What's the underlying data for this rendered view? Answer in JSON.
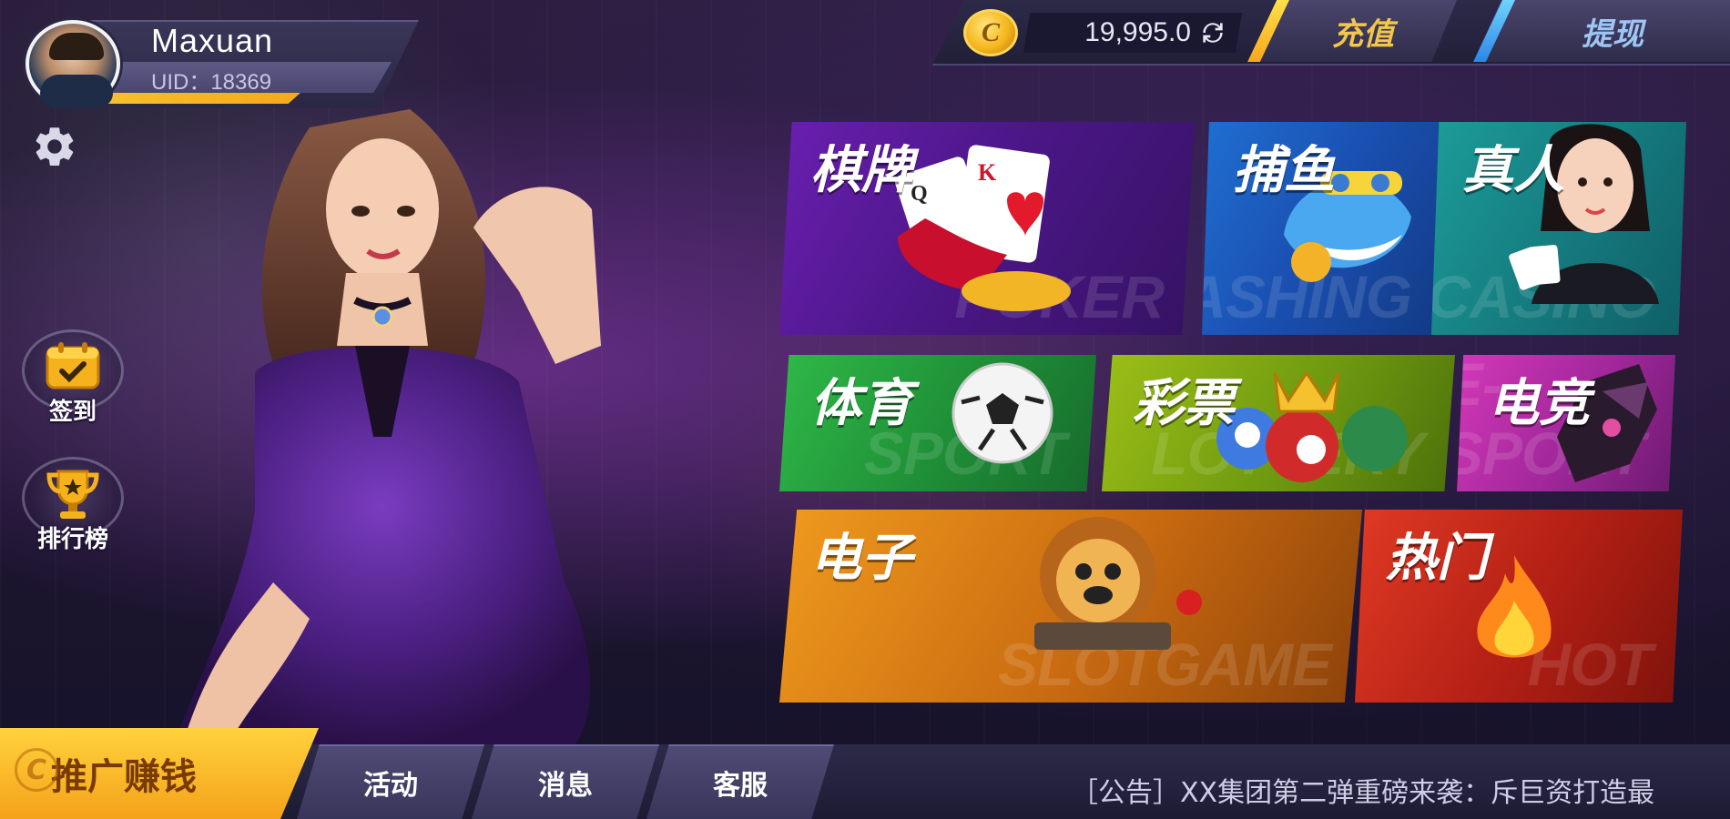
{
  "user": {
    "name": "Maxuan",
    "uid": "UID：18369"
  },
  "wallet": {
    "balance": "19,995.0",
    "recharge_label": "充值",
    "withdraw_label": "提现",
    "coin_symbol": "C"
  },
  "side": {
    "checkin_label": "签到",
    "ranking_label": "排行榜"
  },
  "games": [
    {
      "title": "棋牌",
      "subtitle": "POKER"
    },
    {
      "title": "捕鱼",
      "subtitle": "FASHING"
    },
    {
      "title": "真人",
      "subtitle": "CASINO"
    },
    {
      "title": "体育",
      "subtitle": "SPORT"
    },
    {
      "title": "彩票",
      "subtitle": "LOTTERY"
    },
    {
      "title": "电竞",
      "subtitle": "E-SPORT"
    },
    {
      "title": "电子",
      "subtitle": "SLOTGAME"
    },
    {
      "title": "热门",
      "subtitle": "HOT"
    }
  ],
  "bottom": {
    "promo_label": "推广赚钱",
    "promo_coin": "C",
    "activity_label": "活动",
    "message_label": "消息",
    "service_label": "客服",
    "notice": "［公告］XX集团第二弹重磅来袭：斥巨资打造最"
  },
  "icons": {
    "settings": "gear-icon",
    "checkin": "calendar-check-icon",
    "ranking": "trophy-icon",
    "refresh": "refresh-icon",
    "coin": "coin-icon"
  },
  "colors": {
    "gold": "#f6a81a",
    "recharge_text": "#f3c74a",
    "withdraw_text": "#9ec6f5",
    "poker": "#6a1fb0",
    "fishing": "#1f6fd1",
    "casino": "#1d9c9a",
    "sport": "#2fb948",
    "lottery": "#9cbf17",
    "esport": "#d438b8",
    "slot": "#f09a1e",
    "hot": "#e03a24"
  }
}
